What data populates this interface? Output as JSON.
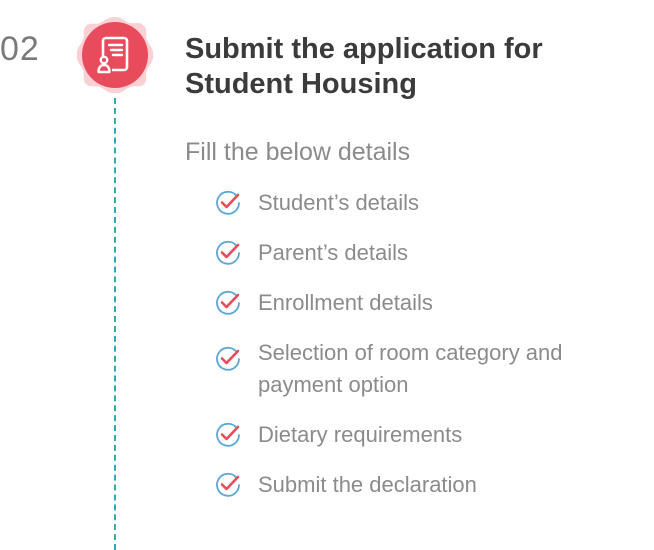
{
  "step": {
    "number": "02",
    "icon": "document-user-icon",
    "title": "Submit the application for Student Housing",
    "subtitle": "Fill the below details",
    "items": [
      {
        "label": "Student’s details"
      },
      {
        "label": "Parent’s details"
      },
      {
        "label": "Enrollment details"
      },
      {
        "label": "Selection of room category and payment option"
      },
      {
        "label": "Dietary requirements"
      },
      {
        "label": "Submit the declaration"
      }
    ]
  },
  "colors": {
    "badge": "#e74b5c",
    "check_circle": "#5aa8d6",
    "check_mark": "#e74b5c",
    "timeline": "#35a7b5",
    "title": "#3b3b3b",
    "text": "#8b8b8b"
  }
}
